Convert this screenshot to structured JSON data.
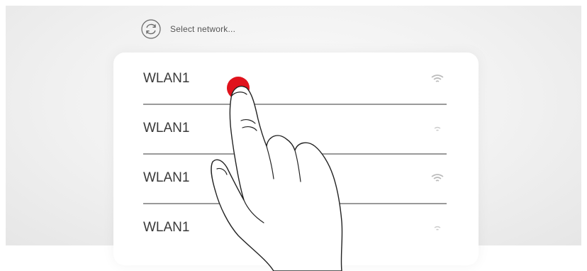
{
  "header": {
    "label": "Select network...",
    "icon": "refresh-icon"
  },
  "networks": [
    {
      "name": "WLAN1",
      "icon": "wifi-strong-icon"
    },
    {
      "name": "WLAN1",
      "icon": "wifi-weak-icon"
    },
    {
      "name": "WLAN1",
      "icon": "wifi-strong-icon"
    },
    {
      "name": "WLAN1",
      "icon": "wifi-weak-icon"
    }
  ],
  "colors": {
    "touch_point": "#e0121c",
    "text": "#3a3a3a",
    "divider": "#9a9a9a"
  }
}
